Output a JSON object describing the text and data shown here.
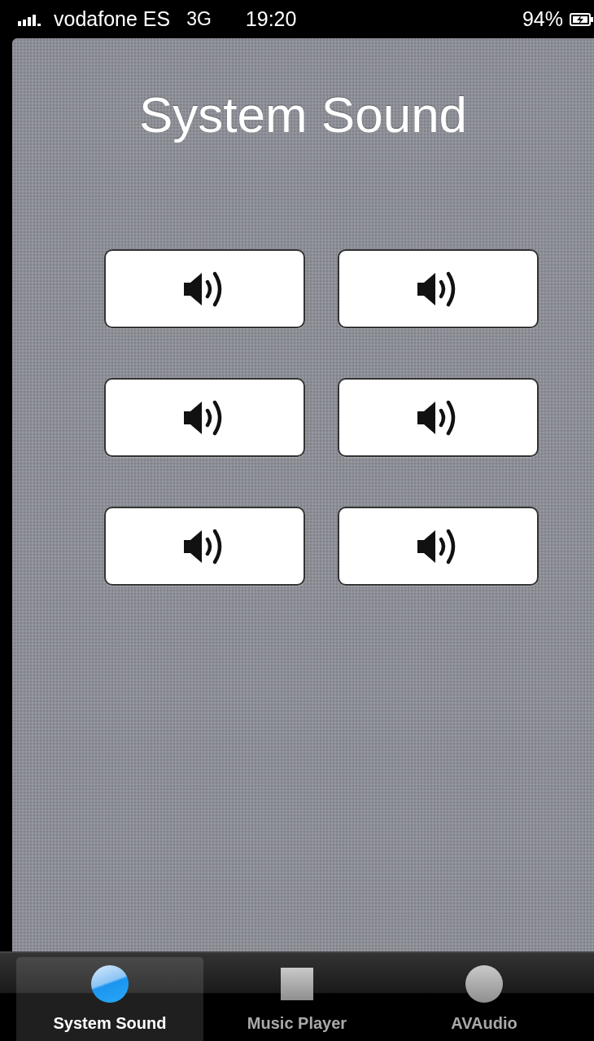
{
  "status_bar": {
    "carrier": "vodafone ES",
    "network": "3G",
    "time": "19:20",
    "battery": "94%",
    "charging": true
  },
  "title": "System Sound",
  "sound_buttons": [
    {
      "kind": "sound"
    },
    {
      "kind": "sound"
    },
    {
      "kind": "sound"
    },
    {
      "kind": "sound"
    },
    {
      "kind": "sound"
    },
    {
      "kind": "sound"
    }
  ],
  "tabs": [
    {
      "label": "System Sound",
      "kind": "circle",
      "selected": true
    },
    {
      "label": "Music Player",
      "kind": "square",
      "selected": false
    },
    {
      "label": "AVAudio",
      "kind": "circle",
      "selected": false
    }
  ]
}
